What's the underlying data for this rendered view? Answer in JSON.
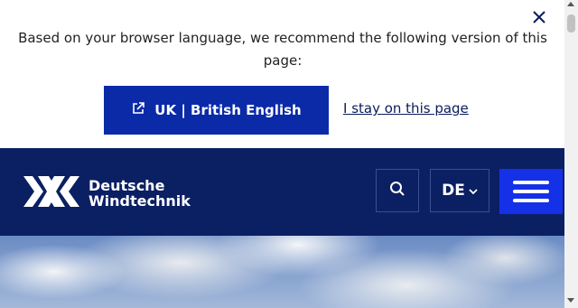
{
  "language_banner": {
    "message": "Based on your browser language, we recommend the following version of this page:",
    "switch_button": "UK | British English",
    "stay_link": "I stay on this page"
  },
  "header": {
    "logo_line1": "Deutsche",
    "logo_line2": "Windtechnik",
    "language": "DE"
  },
  "colors": {
    "header_bg": "#0b1f63",
    "primary_button": "#0b2aa8",
    "menu_button": "#1431e8"
  }
}
